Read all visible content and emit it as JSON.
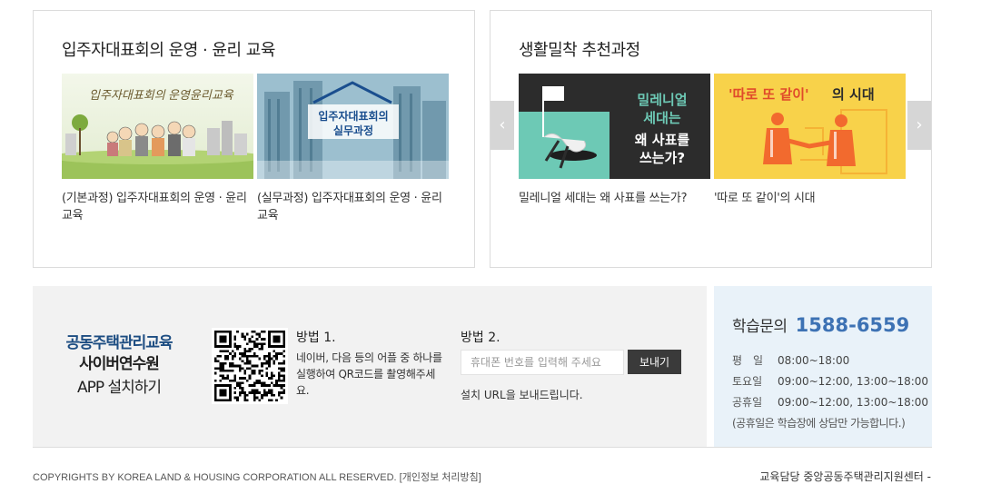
{
  "left_panel": {
    "title": "입주자대표회의 운영 · 윤리 교육",
    "cards": [
      {
        "caption": "(기본과정) 입주자대표회의 운영 · 윤리교육",
        "thumb_text": "입주자대표회의 운영윤리교육"
      },
      {
        "caption": "(실무과정) 입주자대표회의 운영 · 윤리교육",
        "thumb_text_1": "입주자대표회의",
        "thumb_text_2": "실무과정"
      }
    ]
  },
  "right_panel": {
    "title": "생활밀착 추천과정",
    "cards": [
      {
        "caption": "밀레니얼 세대는 왜 사표를 쓰는가?",
        "thumb_lines": [
          "밀레니얼",
          "세대는",
          "왜 사표를",
          "쓰는가?"
        ]
      },
      {
        "caption": "'따로 또 같이'의 시대",
        "thumb_quote": "'따로 또 같이'",
        "thumb_suffix": "의 시대"
      }
    ],
    "prev_icon": "chevron-left-icon",
    "next_icon": "chevron-right-icon",
    "prev_glyph": "‹",
    "next_glyph": "›"
  },
  "app_install": {
    "line1": "공동주택관리교육",
    "line2": "사이버연수원",
    "line3": "APP 설치하기",
    "method1": {
      "title": "방법 1.",
      "desc": "네이버, 다음 등의 어플 중 하나를 실행하여 QR코드를 촬영해주세요."
    },
    "method2": {
      "title": "방법 2.",
      "placeholder": "휴대폰 번호를 입력해 주세요",
      "button": "보내기",
      "desc": "설치 URL을 보내드립니다."
    }
  },
  "help": {
    "label": "학습문의",
    "phone": "1588-6559",
    "rows": [
      {
        "day": "평　일",
        "time": "08:00~18:00"
      },
      {
        "day": "토요일",
        "time": "09:00~12:00, 13:00~18:00"
      },
      {
        "day": "공휴일",
        "time": "09:00~12:00, 13:00~18:00"
      }
    ],
    "note": "(공휴일은 학습장에 상담만 가능합니다.)"
  },
  "footer": {
    "copyright": "COPYRIGHTS BY KOREA LAND & HOUSING CORPORATION ALL RESERVED.",
    "privacy": "[개인정보 처리방침]",
    "right": "교육담당 중앙공동주택관리지원센터 -"
  },
  "colors": {
    "accent_blue": "#3d72b4",
    "title_navy": "#1d4d82",
    "teal": "#6dc9b5",
    "orange": "#f26a2e",
    "yellow": "#f8d24a"
  }
}
